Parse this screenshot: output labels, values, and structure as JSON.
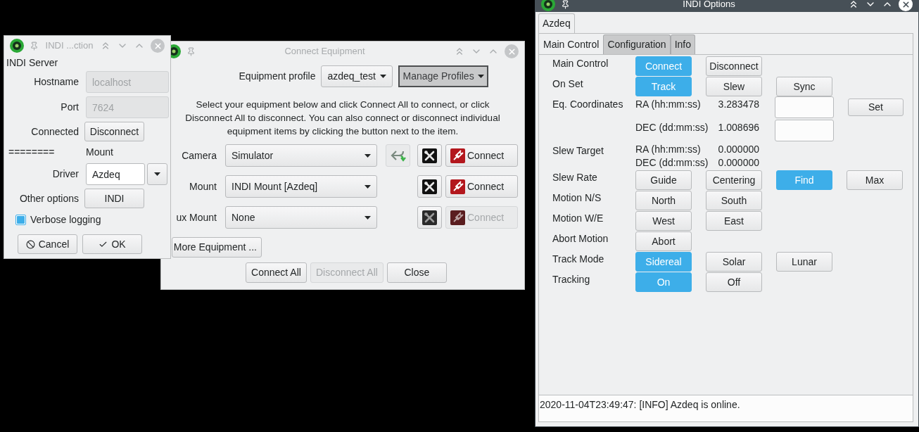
{
  "equipment_window": {
    "title": "Connect Equipment",
    "active": false,
    "profile": {
      "label": "Equipment profile",
      "value": "azdeq_test",
      "manage": "Manage Profiles"
    },
    "description": "Select your equipment below and click Connect All to connect, or click Disconnect All to disconnect. You can also connect or disconnect individual equipment items by clicking the button next to the item.",
    "devices": [
      {
        "label": "Camera",
        "value": "Simulator",
        "swap": true,
        "connect": "Connect",
        "disabled": false
      },
      {
        "label": "Mount",
        "value": "INDI Mount [Azdeq]",
        "swap": false,
        "connect": "Connect",
        "disabled": false
      },
      {
        "label": "ux Mount",
        "value": "None",
        "swap": false,
        "connect": "Connect",
        "disabled": true
      }
    ],
    "more_button": "More Equipment ...",
    "buttons": [
      {
        "label": "Connect All",
        "disabled": false
      },
      {
        "label": "Disconnect All",
        "disabled": true
      },
      {
        "label": "Close",
        "disabled": false
      }
    ]
  },
  "connection_window": {
    "title": "INDI ...ction",
    "active": false,
    "section": "INDI Server",
    "hostname": {
      "label": "Hostname",
      "value": "localhost",
      "disabled": true
    },
    "port": {
      "label": "Port",
      "value": "7624",
      "disabled": true
    },
    "connected": {
      "label": "Connected",
      "button": "Disconnect"
    },
    "separator": "========",
    "device_type": "Mount",
    "driver": {
      "label": "Driver",
      "value": "Azdeq"
    },
    "other_options": {
      "label": "Other options",
      "button": "INDI"
    },
    "verbose_logging": {
      "label": "Verbose logging",
      "checked": true
    },
    "buttons": [
      {
        "kind": "cancel",
        "label": "Cancel"
      },
      {
        "kind": "ok",
        "label": "OK"
      }
    ]
  },
  "options_window": {
    "title": "INDI Options",
    "active": true,
    "device_tabs": [
      {
        "label": "Azdeq",
        "selected": true
      }
    ],
    "tabs": [
      {
        "label": "Main Control",
        "selected": true
      },
      {
        "label": "Configuration",
        "selected": false
      },
      {
        "label": "Info",
        "selected": false
      }
    ],
    "properties": [
      {
        "kind": "switch",
        "label": "Main Control",
        "buttons": [
          {
            "label": "Connect",
            "selected": true
          },
          {
            "label": "Disconnect",
            "selected": false
          }
        ]
      },
      {
        "kind": "switch",
        "label": "On Set",
        "buttons": [
          {
            "label": "Track",
            "selected": true
          },
          {
            "label": "Slew",
            "selected": false
          },
          {
            "label": "Sync",
            "selected": false
          }
        ]
      },
      {
        "kind": "number",
        "label": "Eq. Coordinates",
        "editable": true,
        "set_button": "Set",
        "elements": [
          {
            "name": "RA (hh:mm:ss)",
            "value": "3.283478"
          },
          {
            "name": "DEC (dd:mm:ss)",
            "value": "1.008696"
          }
        ]
      },
      {
        "kind": "number",
        "label": "Slew Target",
        "editable": false,
        "elements": [
          {
            "name": "RA (hh:mm:ss)",
            "value": "0.000000"
          },
          {
            "name": "DEC (dd:mm:ss)",
            "value": "0.000000"
          }
        ]
      },
      {
        "kind": "switch",
        "label": "Slew Rate",
        "buttons": [
          {
            "label": "Guide",
            "selected": false
          },
          {
            "label": "Centering",
            "selected": false
          },
          {
            "label": "Find",
            "selected": true
          },
          {
            "label": "Max",
            "selected": false
          }
        ]
      },
      {
        "kind": "switch",
        "label": "Motion N/S",
        "buttons": [
          {
            "label": "North",
            "selected": false
          },
          {
            "label": "South",
            "selected": false
          }
        ]
      },
      {
        "kind": "switch",
        "label": "Motion W/E",
        "buttons": [
          {
            "label": "West",
            "selected": false
          },
          {
            "label": "East",
            "selected": false
          }
        ]
      },
      {
        "kind": "switch",
        "label": "Abort Motion",
        "buttons": [
          {
            "label": "Abort",
            "selected": false
          }
        ]
      },
      {
        "kind": "switch",
        "label": "Track Mode",
        "buttons": [
          {
            "label": "Sidereal",
            "selected": true
          },
          {
            "label": "Solar",
            "selected": false
          },
          {
            "label": "Lunar",
            "selected": false
          }
        ]
      },
      {
        "kind": "switch",
        "label": "Tracking",
        "buttons": [
          {
            "label": "On",
            "selected": true
          },
          {
            "label": "Off",
            "selected": false
          }
        ]
      }
    ],
    "log": "2020-11-04T23:49:47: [INFO] Azdeq is online."
  }
}
